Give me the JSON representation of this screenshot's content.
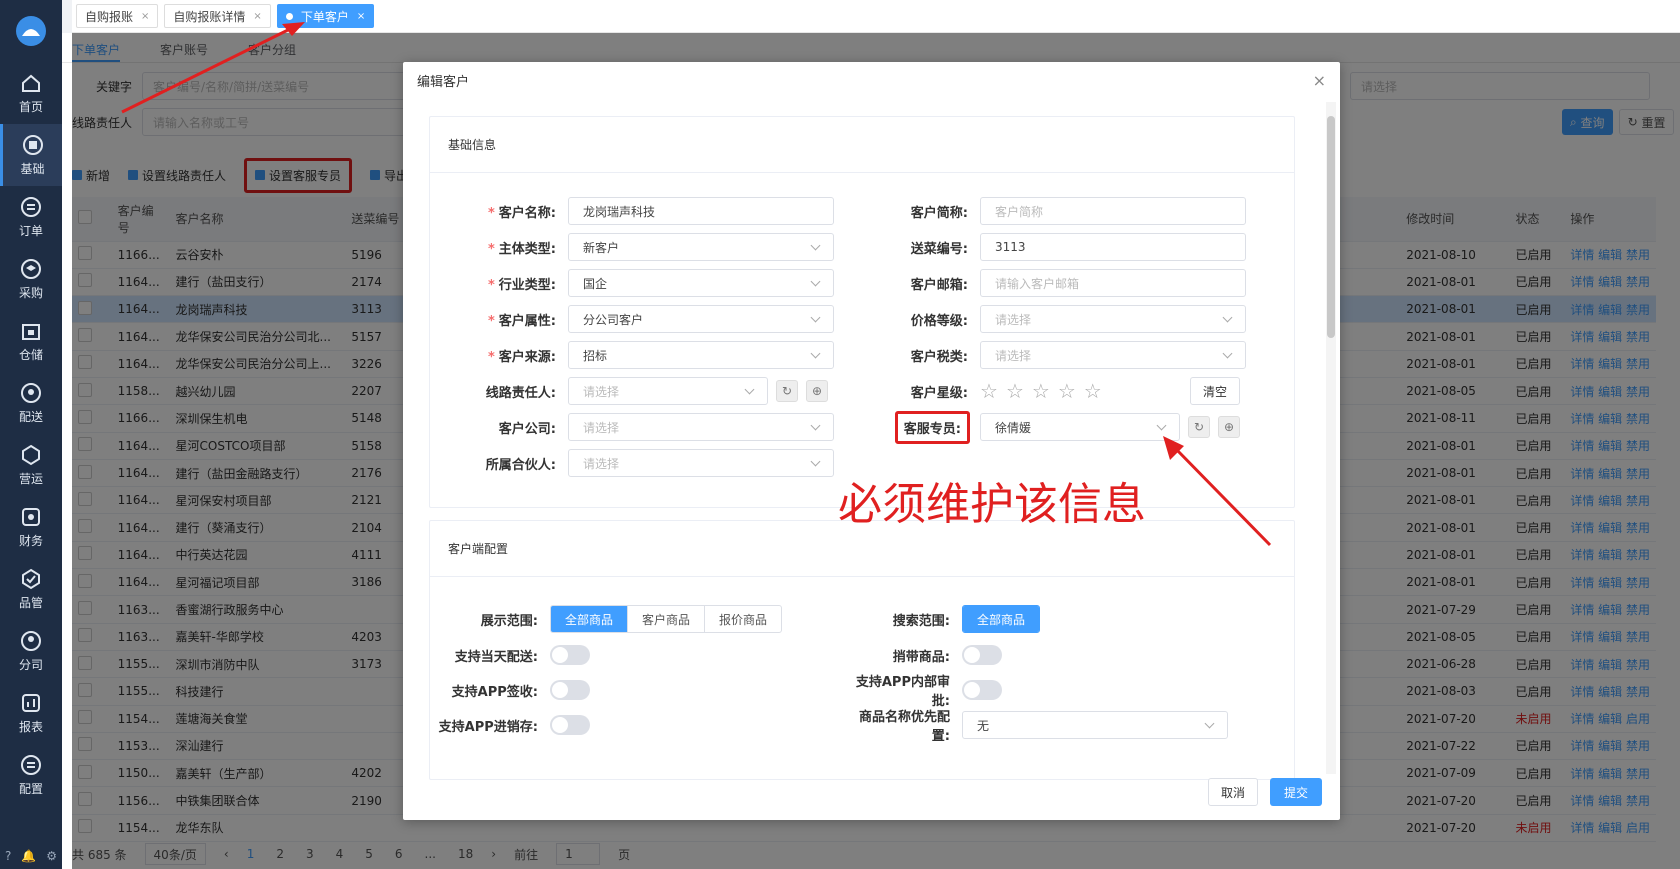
{
  "sidebar": {
    "items": [
      {
        "label": "首页",
        "icon": "home-icon"
      },
      {
        "label": "基础",
        "icon": "doc-icon"
      },
      {
        "label": "订单",
        "icon": "order-icon"
      },
      {
        "label": "采购",
        "icon": "layers-icon"
      },
      {
        "label": "仓储",
        "icon": "warehouse-icon"
      },
      {
        "label": "配送",
        "icon": "location-icon"
      },
      {
        "label": "营运",
        "icon": "hexagon-icon"
      },
      {
        "label": "财务",
        "icon": "finance-icon"
      },
      {
        "label": "品管",
        "icon": "check-icon"
      },
      {
        "label": "分司",
        "icon": "user-icon"
      },
      {
        "label": "报表",
        "icon": "chart-icon"
      },
      {
        "label": "配置",
        "icon": "settings-icon"
      }
    ],
    "bottom": [
      "?",
      "🔔",
      "⚙"
    ]
  },
  "page_tabs": [
    {
      "label": "自购报账",
      "close": "×"
    },
    {
      "label": "自购报账详情",
      "close": "×"
    },
    {
      "label": "下单客户",
      "close": "×"
    }
  ],
  "subtabs": [
    "下单客户",
    "客户账号",
    "客户分组"
  ],
  "filters": {
    "keyword_label": "关键字",
    "keyword_placeholder": "客户编号/名称/简拼/送菜编号",
    "owner_label": "线路责任人",
    "owner_placeholder": "请输入名称或工号",
    "select_placeholder": "请选择",
    "query": "查询",
    "reset": "重置"
  },
  "toolbar": {
    "add": "新增",
    "set_owner": "设置线路责任人",
    "set_cs": "设置客服专员",
    "export": "导出"
  },
  "table": {
    "headers": [
      "客户编号",
      "客户名称",
      "送菜编号",
      "修改时间",
      "状态",
      "操作"
    ],
    "rows": [
      [
        "1166...",
        "云谷安朴",
        "5196",
        "2021-08-10",
        "已启用",
        "详情 编辑 禁用"
      ],
      [
        "1164...",
        "建行（盐田支行）",
        "2174",
        "2021-08-01",
        "已启用",
        "详情 编辑 禁用"
      ],
      [
        "1164...",
        "龙岗瑞声科技",
        "3113",
        "2021-08-01",
        "已启用",
        "详情 编辑 禁用"
      ],
      [
        "1164...",
        "龙华保安公司民治分公司北...",
        "5157",
        "2021-08-01",
        "已启用",
        "详情 编辑 禁用"
      ],
      [
        "1164...",
        "龙华保安公司民治分公司上...",
        "3226",
        "2021-08-01",
        "已启用",
        "详情 编辑 禁用"
      ],
      [
        "1158...",
        "越兴幼儿园",
        "2207",
        "2021-08-05",
        "已启用",
        "详情 编辑 禁用"
      ],
      [
        "1166...",
        "深圳保生机电",
        "5148",
        "2021-08-11",
        "已启用",
        "详情 编辑 禁用"
      ],
      [
        "1164...",
        "星河COSTCO项目部",
        "5158",
        "2021-08-01",
        "已启用",
        "详情 编辑 禁用"
      ],
      [
        "1164...",
        "建行（盐田金融路支行）",
        "2176",
        "2021-08-01",
        "已启用",
        "详情 编辑 禁用"
      ],
      [
        "1164...",
        "星河保安村项目部",
        "2121",
        "2021-08-01",
        "已启用",
        "详情 编辑 禁用"
      ],
      [
        "1164...",
        "建行（葵涌支行）",
        "2104",
        "2021-08-01",
        "已启用",
        "详情 编辑 禁用"
      ],
      [
        "1164...",
        "中行英达花园",
        "4111",
        "2021-08-01",
        "已启用",
        "详情 编辑 禁用"
      ],
      [
        "1164...",
        "星河福记项目部",
        "3186",
        "2021-08-01",
        "已启用",
        "详情 编辑 禁用"
      ],
      [
        "1163...",
        "香蜜湖行政服务中心",
        "",
        "2021-07-29",
        "已启用",
        "详情 编辑 禁用"
      ],
      [
        "1163...",
        "嘉美轩-华郎学校",
        "4203",
        "2021-08-05",
        "已启用",
        "详情 编辑 禁用"
      ],
      [
        "1155...",
        "深圳市消防中队",
        "3173",
        "2021-06-28",
        "已启用",
        "详情 编辑 禁用"
      ],
      [
        "1155...",
        "科技建行",
        "",
        "2021-08-03",
        "已启用",
        "详情 编辑 禁用"
      ],
      [
        "1154...",
        "莲塘海关食堂",
        "",
        "2021-07-20",
        "未启用",
        "详情 编辑 启用"
      ],
      [
        "1153...",
        "深汕建行",
        "",
        "2021-07-22",
        "已启用",
        "详情 编辑 禁用"
      ],
      [
        "1150...",
        "嘉美轩（生产部）",
        "4202",
        "2021-07-09",
        "已启用",
        "详情 编辑 禁用"
      ],
      [
        "1156...",
        "中铁集团联合体",
        "2190",
        "2021-07-20",
        "已启用",
        "详情 编辑 禁用"
      ],
      [
        "1154...",
        "龙华东队",
        "",
        "2021-07-20",
        "未启用",
        "详情 编辑 启用"
      ]
    ]
  },
  "pager": {
    "total": "共 685 条",
    "page_size": "40条/页",
    "pages": [
      "1",
      "2",
      "3",
      "4",
      "5",
      "6",
      "...",
      "18"
    ],
    "goto_label": "前往",
    "goto_value": "1",
    "goto_unit": "页"
  },
  "dialog": {
    "title": "编辑客户",
    "close": "×",
    "basic_title": "基础信息",
    "left_fields": [
      {
        "label": "客户名称:",
        "value": "龙岗瑞声科技",
        "required": "*"
      },
      {
        "label": "主体类型:",
        "value": "新客户",
        "required": "*"
      },
      {
        "label": "行业类型:",
        "value": "国企",
        "required": "*"
      },
      {
        "label": "客户属性:",
        "value": "分公司客户",
        "required": "*"
      },
      {
        "label": "客户来源:",
        "value": "招标",
        "required": "*"
      },
      {
        "label": "线路责任人:",
        "value": "请选择",
        "required": ""
      },
      {
        "label": "客户公司:",
        "value": "请选择",
        "required": ""
      },
      {
        "label": "所属合伙人:",
        "value": "请选择",
        "required": ""
      }
    ],
    "right_fields": [
      {
        "label": "客户简称:",
        "value": "客户简称"
      },
      {
        "label": "送菜编号:",
        "value": "3113"
      },
      {
        "label": "客户邮箱:",
        "value": "请输入客户邮箱"
      },
      {
        "label": "价格等级:",
        "value": "请选择"
      },
      {
        "label": "客户税类:",
        "value": "请选择"
      },
      {
        "label": "客户星级:",
        "value": ""
      },
      {
        "label": "客服专员:",
        "value": "徐倩媛"
      }
    ],
    "clear_btn": "清空",
    "client_title": "客户端配置",
    "display_label": "展示范围:",
    "display_options": [
      "全部商品",
      "客户商品",
      "报价商品"
    ],
    "search_label": "搜索范围:",
    "search_option": "全部商品",
    "same_day_label": "支持当天配送:",
    "carry_label": "捎带商品:",
    "app_sign_label": "支持APP签收:",
    "app_approve_label": "支持APP内部审批:",
    "app_stock_label": "支持APP进销存:",
    "name_priority_label": "商品名称优先配置:",
    "name_priority_value": "无",
    "cancel": "取消",
    "submit": "提交"
  },
  "annotation": "必须维护该信息",
  "colors": {
    "primary": "#409eff",
    "annotation": "#e02020",
    "sidebar": "#1e2d44"
  }
}
